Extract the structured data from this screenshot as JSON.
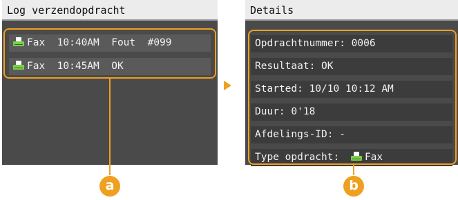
{
  "left_screen": {
    "title": "Log verzendopdracht",
    "jobs": [
      {
        "icon": "fax-icon",
        "text": "Fax  10:40AM  Fout  #099"
      },
      {
        "icon": "fax-icon",
        "text": "Fax  10:45AM  OK"
      }
    ]
  },
  "right_screen": {
    "title": "Details",
    "rows": [
      "Opdrachtnummer: 0006",
      "Resultaat: OK",
      "Started: 10/10 10:12 AM",
      "Duur: 0'18",
      "Afdelings-ID: -"
    ],
    "job_type_label": "Type opdracht:",
    "job_type_icon": "fax-icon",
    "job_type_value": "Fax"
  },
  "callouts": {
    "a": "a",
    "b": "b"
  },
  "colors": {
    "highlight": "#f0a020",
    "screen": "#4a4a4a",
    "fax_icon": "#7ad04a"
  }
}
